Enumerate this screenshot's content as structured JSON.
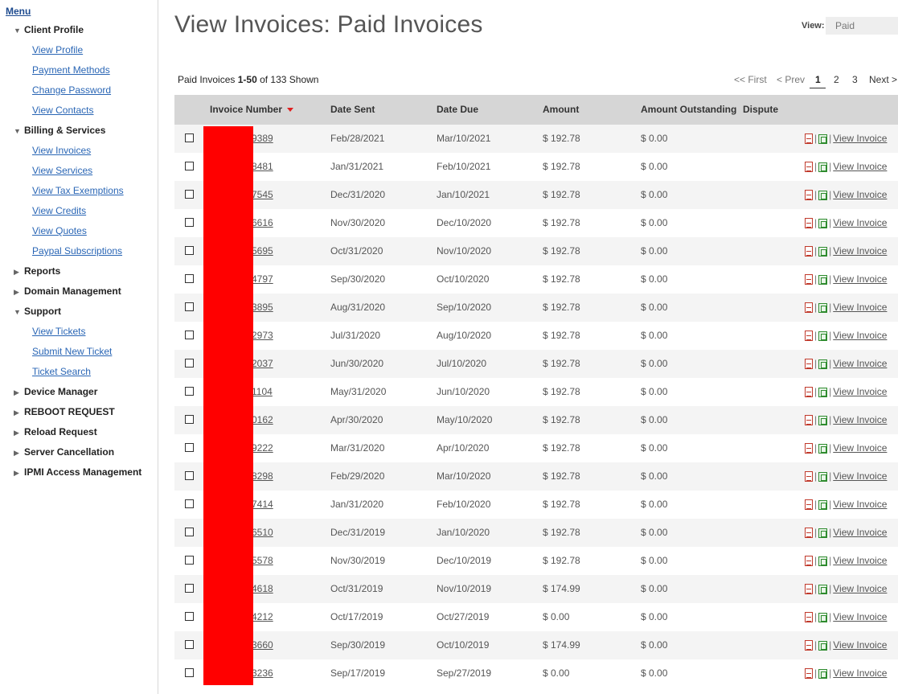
{
  "sidebar": {
    "menu_label": "Menu",
    "sections": [
      {
        "label": "Client Profile",
        "expanded": true,
        "icon": "triangle-down-icon",
        "items": [
          "View Profile",
          "Payment Methods",
          "Change Password",
          "View Contacts"
        ]
      },
      {
        "label": "Billing & Services",
        "expanded": true,
        "icon": "triangle-down-icon",
        "items": [
          "View Invoices",
          "View Services",
          "View Tax Exemptions",
          "View Credits",
          "View Quotes",
          "Paypal Subscriptions"
        ]
      },
      {
        "label": "Reports",
        "expanded": false,
        "icon": "triangle-right-icon",
        "items": []
      },
      {
        "label": "Domain Management",
        "expanded": false,
        "icon": "triangle-right-icon",
        "items": []
      },
      {
        "label": "Support",
        "expanded": true,
        "icon": "triangle-down-icon",
        "items": [
          "View Tickets",
          "Submit New Ticket",
          "Ticket Search"
        ]
      },
      {
        "label": "Device Manager",
        "expanded": false,
        "icon": "triangle-right-icon",
        "items": []
      },
      {
        "label": "REBOOT REQUEST",
        "expanded": false,
        "icon": "triangle-right-icon",
        "items": []
      },
      {
        "label": "Reload Request",
        "expanded": false,
        "icon": "triangle-right-icon",
        "items": []
      },
      {
        "label": "Server Cancellation",
        "expanded": false,
        "icon": "triangle-right-icon",
        "items": []
      },
      {
        "label": "IPMI Access Management",
        "expanded": false,
        "icon": "triangle-right-icon",
        "items": []
      }
    ]
  },
  "header": {
    "title": "View Invoices: Paid Invoices",
    "view_label": "View:",
    "view_value": "Paid"
  },
  "summary": {
    "prefix": "Paid Invoices ",
    "range": "1-50",
    "of_text": " of 133 Shown"
  },
  "pager": {
    "first": "<< First",
    "prev": "< Prev",
    "current": "1",
    "page2": "2",
    "page3": "3",
    "next": "Next >"
  },
  "table": {
    "columns": {
      "invoice": "Invoice Number",
      "sent": "Date Sent",
      "due": "Date Due",
      "amount": "Amount",
      "outstanding": "Amount Outstanding",
      "dispute": "Dispute"
    },
    "action_separator": "|",
    "view_link": "View Invoice",
    "rows": [
      {
        "invoice": "9389",
        "sent": "Feb/28/2021",
        "due": "Mar/10/2021",
        "amount": "$ 192.78",
        "outstanding": "$ 0.00"
      },
      {
        "invoice": "8481",
        "sent": "Jan/31/2021",
        "due": "Feb/10/2021",
        "amount": "$ 192.78",
        "outstanding": "$ 0.00"
      },
      {
        "invoice": "7545",
        "sent": "Dec/31/2020",
        "due": "Jan/10/2021",
        "amount": "$ 192.78",
        "outstanding": "$ 0.00"
      },
      {
        "invoice": "6616",
        "sent": "Nov/30/2020",
        "due": "Dec/10/2020",
        "amount": "$ 192.78",
        "outstanding": "$ 0.00"
      },
      {
        "invoice": "5695",
        "sent": "Oct/31/2020",
        "due": "Nov/10/2020",
        "amount": "$ 192.78",
        "outstanding": "$ 0.00"
      },
      {
        "invoice": "4797",
        "sent": "Sep/30/2020",
        "due": "Oct/10/2020",
        "amount": "$ 192.78",
        "outstanding": "$ 0.00"
      },
      {
        "invoice": "3895",
        "sent": "Aug/31/2020",
        "due": "Sep/10/2020",
        "amount": "$ 192.78",
        "outstanding": "$ 0.00"
      },
      {
        "invoice": "2973",
        "sent": "Jul/31/2020",
        "due": "Aug/10/2020",
        "amount": "$ 192.78",
        "outstanding": "$ 0.00"
      },
      {
        "invoice": "2037",
        "sent": "Jun/30/2020",
        "due": "Jul/10/2020",
        "amount": "$ 192.78",
        "outstanding": "$ 0.00"
      },
      {
        "invoice": "1104",
        "sent": "May/31/2020",
        "due": "Jun/10/2020",
        "amount": "$ 192.78",
        "outstanding": "$ 0.00"
      },
      {
        "invoice": "0162",
        "sent": "Apr/30/2020",
        "due": "May/10/2020",
        "amount": "$ 192.78",
        "outstanding": "$ 0.00"
      },
      {
        "invoice": "9222",
        "sent": "Mar/31/2020",
        "due": "Apr/10/2020",
        "amount": "$ 192.78",
        "outstanding": "$ 0.00"
      },
      {
        "invoice": "8298",
        "sent": "Feb/29/2020",
        "due": "Mar/10/2020",
        "amount": "$ 192.78",
        "outstanding": "$ 0.00"
      },
      {
        "invoice": "7414",
        "sent": "Jan/31/2020",
        "due": "Feb/10/2020",
        "amount": "$ 192.78",
        "outstanding": "$ 0.00"
      },
      {
        "invoice": "6510",
        "sent": "Dec/31/2019",
        "due": "Jan/10/2020",
        "amount": "$ 192.78",
        "outstanding": "$ 0.00"
      },
      {
        "invoice": "5578",
        "sent": "Nov/30/2019",
        "due": "Dec/10/2019",
        "amount": "$ 192.78",
        "outstanding": "$ 0.00"
      },
      {
        "invoice": "4618",
        "sent": "Oct/31/2019",
        "due": "Nov/10/2019",
        "amount": "$ 174.99",
        "outstanding": "$ 0.00"
      },
      {
        "invoice": "4212",
        "sent": "Oct/17/2019",
        "due": "Oct/27/2019",
        "amount": "$ 0.00",
        "outstanding": "$ 0.00"
      },
      {
        "invoice": "3660",
        "sent": "Sep/30/2019",
        "due": "Oct/10/2019",
        "amount": "$ 174.99",
        "outstanding": "$ 0.00"
      },
      {
        "invoice": "3236",
        "sent": "Sep/17/2019",
        "due": "Sep/27/2019",
        "amount": "$ 0.00",
        "outstanding": "$ 0.00"
      }
    ]
  },
  "colors": {
    "link": "#2a66b5",
    "header_bg": "#d6d6d6",
    "row_alt": "#f4f4f4",
    "redaction": "#ff0000",
    "sort_arrow": "#e02020"
  }
}
